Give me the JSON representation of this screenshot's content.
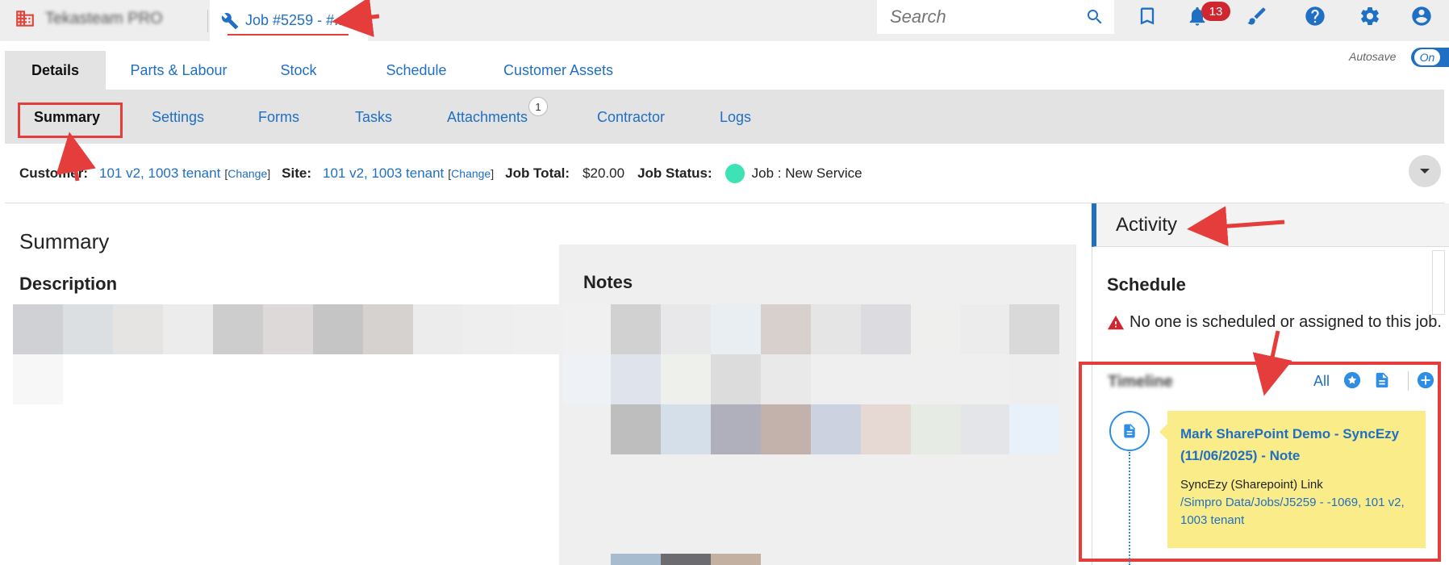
{
  "topbar": {
    "company_name": "Tekasteam PRO",
    "job_tab": "Job #5259 - #...",
    "search_placeholder": "Search",
    "notification_count": "13"
  },
  "tabs_primary": [
    {
      "label": "Details",
      "active": true
    },
    {
      "label": "Parts & Labour"
    },
    {
      "label": "Stock"
    },
    {
      "label": "Schedule"
    },
    {
      "label": "Customer Assets"
    }
  ],
  "autosave": {
    "label": "Autosave",
    "state": "On"
  },
  "tabs_secondary": [
    {
      "label": "Summary",
      "active": true
    },
    {
      "label": "Settings"
    },
    {
      "label": "Forms"
    },
    {
      "label": "Tasks"
    },
    {
      "label": "Attachments",
      "count": "1"
    },
    {
      "label": "Contractor"
    },
    {
      "label": "Logs"
    }
  ],
  "info": {
    "customer_label": "Customer:",
    "customer_value": "101 v2, 1003 tenant",
    "change_label": "Change",
    "site_label": "Site:",
    "site_value": "101 v2, 1003 tenant",
    "total_label": "Job Total:",
    "total_value": "$20.00",
    "status_label": "Job Status:",
    "status_value": "Job : New Service",
    "status_color": "#3de3b4"
  },
  "summary": {
    "heading": "Summary",
    "description_heading": "Description",
    "notes_heading": "Notes"
  },
  "activity": {
    "heading": "Activity",
    "schedule_heading": "Schedule",
    "schedule_message": "No one is scheduled or assigned to this job.",
    "timeline_heading": "Timeline",
    "filter_all": "All",
    "note": {
      "title": "Mark SharePoint Demo - SyncEzy (11/06/2025) - Note",
      "subtitle": "SyncEzy (Sharepoint) Link",
      "link": "/Simpro Data/Jobs/J5259 - -1069, 101 v2, 1003 tenant"
    }
  },
  "colors": {
    "accent": "#1f6fc4",
    "annotation": "#e53c3c",
    "badge": "#d0262f",
    "note_bg": "#fbec8a"
  }
}
